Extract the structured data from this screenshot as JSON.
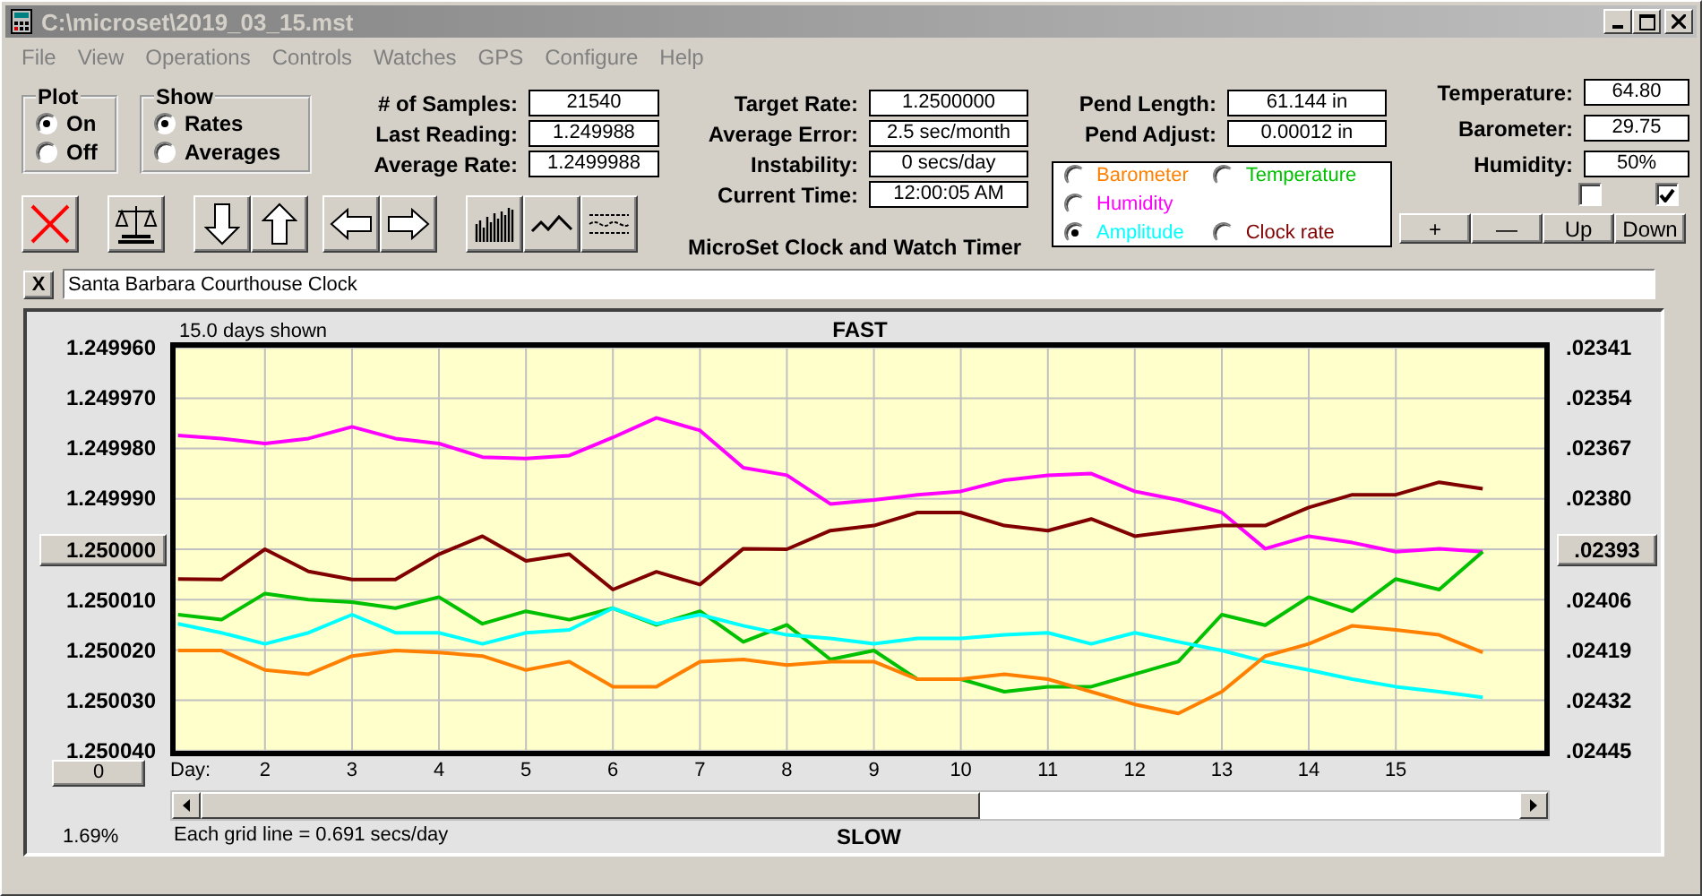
{
  "window": {
    "title": "C:\\microset\\2019_03_15.mst"
  },
  "menu": [
    "File",
    "View",
    "Operations",
    "Controls",
    "Watches",
    "GPS",
    "Configure",
    "Help"
  ],
  "plot_group": {
    "title": "Plot",
    "options": [
      {
        "label": "On",
        "selected": true
      },
      {
        "label": "Off",
        "selected": false
      }
    ]
  },
  "show_group": {
    "title": "Show",
    "options": [
      {
        "label": "Rates",
        "selected": true
      },
      {
        "label": "Averages",
        "selected": false
      }
    ]
  },
  "readings": [
    {
      "label": "# of Samples:",
      "value": "21540"
    },
    {
      "label": "Last Reading:",
      "value": "1.249988"
    },
    {
      "label": "Average Rate:",
      "value": "1.2499988"
    }
  ],
  "rates": [
    {
      "label": "Target Rate:",
      "value": "1.2500000"
    },
    {
      "label": "Average Error:",
      "value": "2.5 sec/month"
    },
    {
      "label": "Instability:",
      "value": "0 secs/day"
    },
    {
      "label": "Current Time:",
      "value": "12:00:05 AM"
    }
  ],
  "caption": "MicroSet Clock and Watch Timer",
  "pendulum": [
    {
      "label": "Pend Length:",
      "value": "61.144 in"
    },
    {
      "label": "Pend Adjust:",
      "value": "0.00012 in"
    }
  ],
  "plot_selector": {
    "columns": [
      [
        {
          "label": "Barometer",
          "color": "#ff8000",
          "selected": false
        },
        {
          "label": "Humidity",
          "color": "#ff00ff",
          "selected": false
        },
        {
          "label": "Amplitude",
          "color": "#00ffff",
          "selected": true
        }
      ],
      [
        {
          "label": "Temperature",
          "color": "#00c000",
          "selected": false
        },
        {
          "label": "Clock rate",
          "color": "#800000",
          "selected": false
        }
      ]
    ]
  },
  "environment": [
    {
      "label": "Temperature:",
      "value": "64.80"
    },
    {
      "label": "Barometer:",
      "value": "29.75"
    },
    {
      "label": "Humidity:",
      "value": "50%"
    }
  ],
  "checkboxes": [
    {
      "checked": false
    },
    {
      "checked": true
    }
  ],
  "adjust_buttons": [
    "+",
    "—",
    "Up",
    "Down"
  ],
  "clock_name": {
    "close": "X",
    "value": "Santa Barbara Courthouse Clock"
  },
  "chart_panel": {
    "days_shown": "15.0 days shown",
    "top_label": "FAST",
    "bottom_label": "SLOW",
    "grid_note": "Each grid line = 0.691 secs/day",
    "percent": "1.69%",
    "zero_button": "0",
    "left_reference_button": "1.250000",
    "right_axis": [
      {
        "label": ".02341",
        "kind": "text"
      },
      {
        "label": ".02354",
        "kind": "text"
      },
      {
        "label": ".02367",
        "kind": "text"
      },
      {
        "label": ".02380",
        "kind": "text"
      },
      {
        "label": ".02393",
        "kind": "button"
      },
      {
        "label": ".02406",
        "kind": "text"
      },
      {
        "label": ".02419",
        "kind": "text"
      },
      {
        "label": ".02432",
        "kind": "text"
      },
      {
        "label": ".02445",
        "kind": "text"
      }
    ],
    "chart_data": {
      "type": "line",
      "xlabel": "Day:",
      "xlim": [
        0.91,
        16.77
      ],
      "ylim": [
        1.2500411,
        1.2499589
      ],
      "grid": true,
      "xticks": [
        2,
        3,
        4,
        5,
        6,
        7,
        8,
        9,
        10,
        11,
        12,
        13,
        14,
        15
      ],
      "yticks": [
        {
          "value": 1.24996,
          "label": "1.249960"
        },
        {
          "value": 1.24997,
          "label": "1.249970"
        },
        {
          "value": 1.24998,
          "label": "1.249980"
        },
        {
          "value": 1.24999,
          "label": "1.249990"
        },
        {
          "value": 1.25001,
          "label": "1.250010"
        },
        {
          "value": 1.25002,
          "label": "1.250020"
        },
        {
          "value": 1.25003,
          "label": "1.250030"
        },
        {
          "value": 1.25004,
          "label": "1.250040"
        }
      ],
      "x": [
        1,
        1.5,
        2,
        2.5,
        3,
        3.5,
        4,
        4.5,
        5,
        5.5,
        6,
        6.5,
        7,
        7.5,
        8,
        8.5,
        9,
        9.5,
        10,
        10.5,
        11,
        11.5,
        12,
        12.5,
        13,
        13.5,
        14,
        14.5,
        15,
        15.5,
        16
      ],
      "series": [
        {
          "color": "#ff00ff",
          "values": [
            1.2499774,
            1.249978,
            1.249979,
            1.249978,
            1.2499757,
            1.249978,
            1.249979,
            1.2499817,
            1.249982,
            1.2499814,
            1.2499778,
            1.2499739,
            1.2499764,
            1.2499838,
            1.2499853,
            1.249991,
            1.2499902,
            1.2499892,
            1.2499885,
            1.2499863,
            1.2499853,
            1.249985,
            1.2499885,
            1.2499902,
            1.2499927,
            1.2499999,
            1.2499974,
            1.2499987,
            1.2500005,
            1.2499999,
            1.2500005
          ]
        },
        {
          "color": "#800000",
          "values": [
            1.2500059,
            1.250006,
            1.25,
            1.2500044,
            1.250006,
            1.250006,
            1.250001,
            1.2499974,
            1.2500023,
            1.250001,
            1.250008,
            1.2500045,
            1.250007,
            1.2499999,
            1.25,
            1.2499963,
            1.2499953,
            1.2499927,
            1.2499927,
            1.2499953,
            1.2499963,
            1.249994,
            1.2499974,
            1.2499963,
            1.2499953,
            1.2499953,
            1.2499917,
            1.2499892,
            1.2499892,
            1.2499867,
            1.249988
          ]
        },
        {
          "color": "#00c000",
          "values": [
            1.250013,
            1.250014,
            1.2500088,
            1.25001,
            1.2500105,
            1.2500117,
            1.2500095,
            1.2500148,
            1.2500123,
            1.250014,
            1.2500117,
            1.250015,
            1.2500123,
            1.2500184,
            1.250015,
            1.2500219,
            1.2500201,
            1.2500258,
            1.2500258,
            1.2500283,
            1.2500273,
            1.2500273,
            1.2500248,
            1.2500223,
            1.250013,
            1.2500151,
            1.2500095,
            1.2500123,
            1.2500059,
            1.250008,
            1.2500005
          ]
        },
        {
          "color": "#00ffff",
          "values": [
            1.2500148,
            1.2500166,
            1.2500188,
            1.2500166,
            1.250013,
            1.2500166,
            1.2500166,
            1.2500188,
            1.2500166,
            1.250016,
            1.2500117,
            1.2500148,
            1.250013,
            1.2500152,
            1.250017,
            1.2500177,
            1.2500188,
            1.2500177,
            1.2500177,
            1.250017,
            1.2500166,
            1.2500188,
            1.2500166,
            1.2500184,
            1.2500201,
            1.2500223,
            1.250024,
            1.2500258,
            1.2500273,
            1.2500283,
            1.2500294
          ]
        },
        {
          "color": "#ff8000",
          "values": [
            1.2500201,
            1.2500201,
            1.250024,
            1.2500248,
            1.2500212,
            1.2500201,
            1.2500205,
            1.2500212,
            1.250024,
            1.2500223,
            1.2500273,
            1.2500273,
            1.2500223,
            1.2500219,
            1.250023,
            1.2500223,
            1.2500223,
            1.2500258,
            1.2500258,
            1.2500248,
            1.2500258,
            1.2500283,
            1.2500308,
            1.2500326,
            1.2500283,
            1.2500212,
            1.2500188,
            1.2500152,
            1.250016,
            1.250017,
            1.2500205
          ]
        }
      ]
    }
  }
}
